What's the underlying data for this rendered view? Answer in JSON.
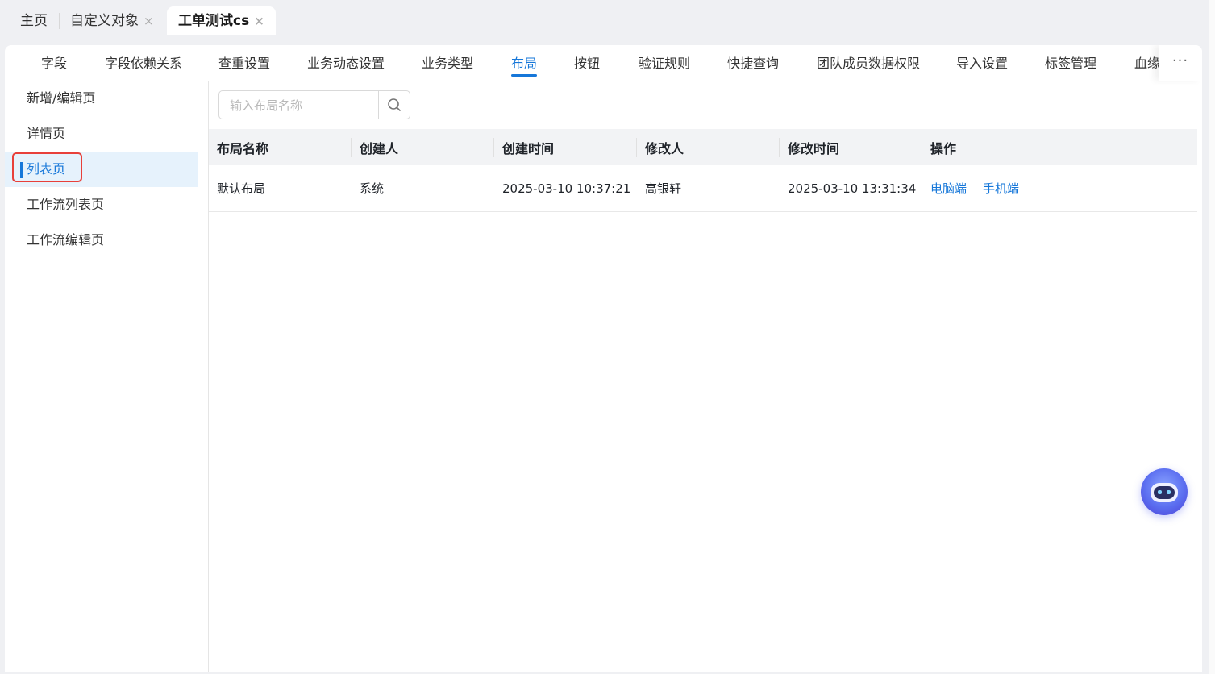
{
  "page_tabs": [
    {
      "label": "主页",
      "closable": false
    },
    {
      "label": "自定义对象",
      "closable": true
    },
    {
      "label": "工单测试cs",
      "closable": true,
      "active": true
    }
  ],
  "close_glyph": "×",
  "sub_tabs": [
    "字段",
    "字段依赖关系",
    "查重设置",
    "业务动态设置",
    "业务类型",
    "布局",
    "按钮",
    "验证规则",
    "快捷查询",
    "团队成员数据权限",
    "导入设置",
    "标签管理",
    "血缘"
  ],
  "active_sub_tab": "布局",
  "more_label": "···",
  "left_menu": [
    "新增/编辑页",
    "详情页",
    "列表页",
    "工作流列表页",
    "工作流编辑页"
  ],
  "active_left_menu": "列表页",
  "search": {
    "placeholder": "输入布局名称",
    "value": ""
  },
  "table": {
    "headers": [
      "布局名称",
      "创建人",
      "创建时间",
      "修改人",
      "修改时间",
      "操作"
    ],
    "rows": [
      {
        "name": "默认布局",
        "creator": "系统",
        "created_at": "2025-03-10 10:37:21",
        "modifier": "高银轩",
        "modified_at": "2025-03-10 13:31:34",
        "actions": [
          "电脑端",
          "手机端"
        ]
      }
    ]
  },
  "colors": {
    "accent": "#1677d9",
    "highlight_border": "#e8403a",
    "active_menu_bg": "#e6f2fc"
  },
  "icons": {
    "search": "search-icon",
    "close": "close-icon",
    "assistant": "robot-assistant-icon"
  }
}
